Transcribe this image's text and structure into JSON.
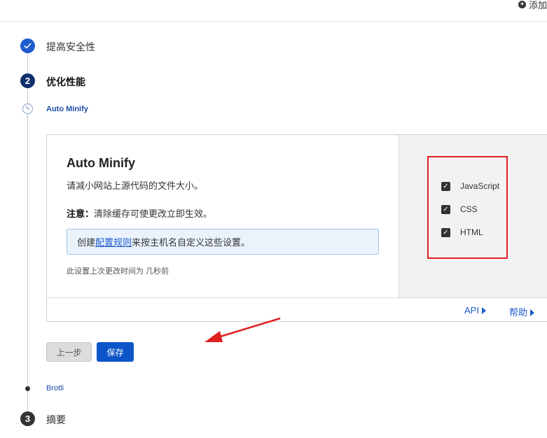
{
  "header": {
    "add_label": "添加"
  },
  "steps": [
    {
      "label": "提高安全性",
      "state": "done"
    },
    {
      "number": "2",
      "label": "优化性能",
      "state": "active"
    },
    {
      "number": "3",
      "label": "摘要",
      "state": "todo"
    }
  ],
  "substeps": {
    "current": "Auto Minify",
    "next": "Brotli"
  },
  "card": {
    "title": "Auto Minify",
    "description": "请减小网站上源代码的文件大小。",
    "note_label": "注意：",
    "note_text": "清除缓存可使更改立即生效。",
    "info_prefix": "创建",
    "info_link": "配置规则",
    "info_suffix": "来按主机名自定义这些设置。",
    "last_modified": "此设置上次更改时间为 几秒前",
    "options": [
      {
        "label": "JavaScript",
        "checked": true
      },
      {
        "label": "CSS",
        "checked": true
      },
      {
        "label": "HTML",
        "checked": true
      }
    ],
    "footer": {
      "api_label": "API",
      "help_label": "帮助"
    }
  },
  "buttons": {
    "back_label": "上一步",
    "save_label": "保存"
  },
  "colors": {
    "primary": "#0b55c9",
    "highlight_border": "#e02020",
    "annotation_arrow": "#e02020"
  }
}
